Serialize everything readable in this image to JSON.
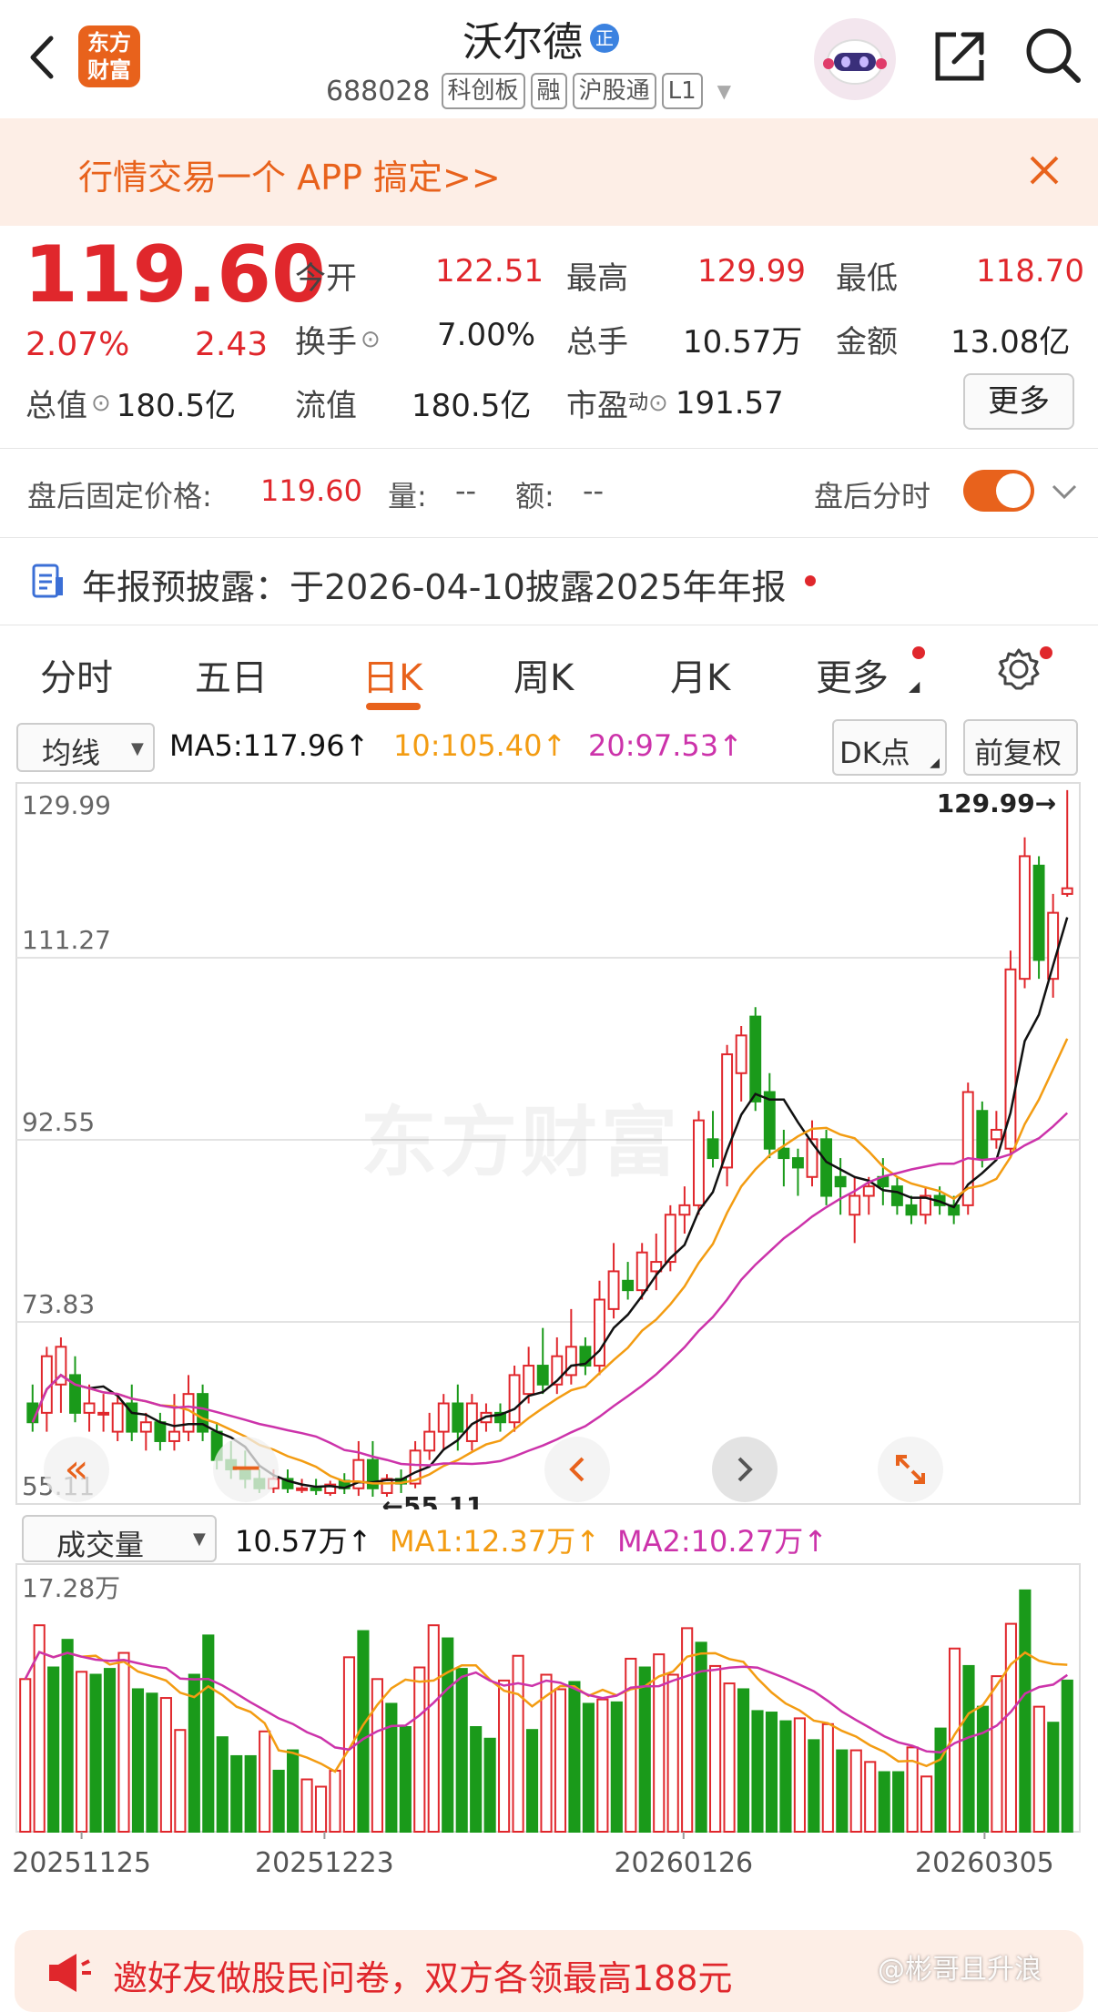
{
  "header": {
    "logo_text": "东方财富",
    "stock_name": "沃尔德",
    "certified_badge": "正",
    "stock_code": "688028",
    "tags": [
      "科创板",
      "融",
      "沪股通",
      "L1"
    ]
  },
  "banner": {
    "text": "行情交易一个 APP 搞定>>"
  },
  "quote": {
    "price": "119.60",
    "change_pct": "2.07%",
    "change_amt": "2.43",
    "open_label": "今开",
    "open": "122.51",
    "high_label": "最高",
    "high": "129.99",
    "low_label": "最低",
    "low": "118.70",
    "turnover_label": "换手",
    "turnover": "7.00%",
    "volume_label": "总手",
    "volume": "10.57万",
    "amount_label": "金额",
    "amount": "13.08亿",
    "mktcap_label": "总值",
    "mktcap": "180.5亿",
    "float_label": "流值",
    "float": "180.5亿",
    "pe_label": "市盈",
    "pe_sup": "动",
    "pe": "191.57",
    "more_button": "更多"
  },
  "after_hours": {
    "price_label": "盘后固定价格:",
    "price": "119.60",
    "vol_label": "量:",
    "vol": "--",
    "amt_label": "额:",
    "amt": "--",
    "timeshare_label": "盘后分时"
  },
  "notice": {
    "text": "年报预披露：于2026-04-10披露2025年年报"
  },
  "tabs": [
    "分时",
    "五日",
    "日K",
    "周K",
    "月K",
    "更多"
  ],
  "active_tab": "日K",
  "kline_toolbar": {
    "indicator": "均线",
    "ma5": "MA5:117.96↑",
    "ma10": "10:105.40↑",
    "ma20": "20:97.53↑",
    "dk_button": "DK点",
    "adjust_button": "前复权"
  },
  "volume_toolbar": {
    "indicator": "成交量",
    "vol": "10.57万↑",
    "ma1": "MA1:12.37万↑",
    "ma2": "MA2:10.27万↑"
  },
  "watermark": "东方财富",
  "footer": {
    "promo_text": "邀好友做股民问卷，双方各领最高188元",
    "weibo_watermark": "@彬哥且升浪"
  },
  "colors": {
    "up": "#e0272c",
    "down": "#1a9a1a",
    "ma5": "#111111",
    "ma10": "#f39c12",
    "ma20": "#cc33aa",
    "accent": "#e8621c",
    "banner_bg": "#fdeee6"
  },
  "chart_data": [
    {
      "type": "candlestick",
      "title": "",
      "y_ticks": [
        "129.99",
        "111.27",
        "92.55",
        "73.83",
        "55.11"
      ],
      "ylim": [
        55.11,
        129.99
      ],
      "max_label": "129.99→",
      "min_label": "←55.11",
      "candles": [
        {
          "o": 65,
          "h": 67,
          "l": 62,
          "c": 63
        },
        {
          "o": 64,
          "h": 71,
          "l": 62,
          "c": 70
        },
        {
          "o": 67,
          "h": 72,
          "l": 64,
          "c": 71
        },
        {
          "o": 68,
          "h": 70,
          "l": 63,
          "c": 64
        },
        {
          "o": 64,
          "h": 67,
          "l": 62,
          "c": 65
        },
        {
          "o": 64,
          "h": 66,
          "l": 62,
          "c": 64
        },
        {
          "o": 62,
          "h": 66,
          "l": 61,
          "c": 65
        },
        {
          "o": 65,
          "h": 67,
          "l": 61,
          "c": 62
        },
        {
          "o": 62,
          "h": 64,
          "l": 60,
          "c": 63
        },
        {
          "o": 63,
          "h": 64,
          "l": 60,
          "c": 61
        },
        {
          "o": 61,
          "h": 66,
          "l": 60,
          "c": 62
        },
        {
          "o": 62,
          "h": 68,
          "l": 61,
          "c": 66
        },
        {
          "o": 66,
          "h": 67,
          "l": 61,
          "c": 62
        },
        {
          "o": 62,
          "h": 63,
          "l": 58,
          "c": 59
        },
        {
          "o": 59,
          "h": 61,
          "l": 57,
          "c": 58
        },
        {
          "o": 58,
          "h": 60,
          "l": 56,
          "c": 57
        },
        {
          "o": 57,
          "h": 58,
          "l": 55.5,
          "c": 56
        },
        {
          "o": 56,
          "h": 58,
          "l": 55.5,
          "c": 57
        },
        {
          "o": 57,
          "h": 58,
          "l": 55.5,
          "c": 56
        },
        {
          "o": 56,
          "h": 57,
          "l": 55.5,
          "c": 56
        },
        {
          "o": 56,
          "h": 57,
          "l": 55.3,
          "c": 55.8
        },
        {
          "o": 55.5,
          "h": 56.8,
          "l": 55.2,
          "c": 56.4
        },
        {
          "o": 56.8,
          "h": 57.6,
          "l": 55.4,
          "c": 56
        },
        {
          "o": 56,
          "h": 61,
          "l": 55.2,
          "c": 59
        },
        {
          "o": 59,
          "h": 61,
          "l": 55.11,
          "c": 56
        },
        {
          "o": 55.5,
          "h": 57.5,
          "l": 55.11,
          "c": 57
        },
        {
          "o": 57,
          "h": 58,
          "l": 55.5,
          "c": 56.5
        },
        {
          "o": 56.5,
          "h": 61,
          "l": 56,
          "c": 60
        },
        {
          "o": 60,
          "h": 64,
          "l": 59,
          "c": 62
        },
        {
          "o": 62,
          "h": 66,
          "l": 60,
          "c": 65
        },
        {
          "o": 65,
          "h": 67,
          "l": 60,
          "c": 62
        },
        {
          "o": 61,
          "h": 66,
          "l": 60,
          "c": 65
        },
        {
          "o": 63,
          "h": 65,
          "l": 62,
          "c": 64
        },
        {
          "o": 64,
          "h": 65,
          "l": 62,
          "c": 63
        },
        {
          "o": 63,
          "h": 69,
          "l": 62,
          "c": 68
        },
        {
          "o": 66,
          "h": 71,
          "l": 65,
          "c": 69
        },
        {
          "o": 69,
          "h": 73,
          "l": 66,
          "c": 67
        },
        {
          "o": 67,
          "h": 72,
          "l": 66,
          "c": 70
        },
        {
          "o": 68,
          "h": 75,
          "l": 67,
          "c": 71
        },
        {
          "o": 71,
          "h": 72,
          "l": 68,
          "c": 69
        },
        {
          "o": 69,
          "h": 78,
          "l": 68,
          "c": 76
        },
        {
          "o": 75,
          "h": 82,
          "l": 74,
          "c": 79
        },
        {
          "o": 78,
          "h": 80,
          "l": 76,
          "c": 77
        },
        {
          "o": 77,
          "h": 82,
          "l": 76,
          "c": 81
        },
        {
          "o": 79,
          "h": 83,
          "l": 77,
          "c": 80
        },
        {
          "o": 80,
          "h": 86,
          "l": 79,
          "c": 85
        },
        {
          "o": 85,
          "h": 88,
          "l": 83,
          "c": 86
        },
        {
          "o": 86,
          "h": 96,
          "l": 85,
          "c": 95
        },
        {
          "o": 93,
          "h": 96,
          "l": 90,
          "c": 91
        },
        {
          "o": 90,
          "h": 103,
          "l": 88,
          "c": 102
        },
        {
          "o": 100,
          "h": 105,
          "l": 97,
          "c": 104
        },
        {
          "o": 106,
          "h": 107,
          "l": 96,
          "c": 97
        },
        {
          "o": 98,
          "h": 100,
          "l": 91,
          "c": 92
        },
        {
          "o": 92,
          "h": 94,
          "l": 88,
          "c": 91
        },
        {
          "o": 91,
          "h": 92,
          "l": 87,
          "c": 90
        },
        {
          "o": 89,
          "h": 95,
          "l": 88,
          "c": 93
        },
        {
          "o": 93,
          "h": 94,
          "l": 86,
          "c": 87
        },
        {
          "o": 89,
          "h": 91,
          "l": 85,
          "c": 88
        },
        {
          "o": 85,
          "h": 89,
          "l": 82,
          "c": 87
        },
        {
          "o": 87,
          "h": 89,
          "l": 85,
          "c": 88
        },
        {
          "o": 89,
          "h": 91,
          "l": 86,
          "c": 88
        },
        {
          "o": 88,
          "h": 89,
          "l": 85,
          "c": 86
        },
        {
          "o": 86,
          "h": 87,
          "l": 84,
          "c": 85
        },
        {
          "o": 85,
          "h": 88,
          "l": 84,
          "c": 87
        },
        {
          "o": 87,
          "h": 88,
          "l": 85,
          "c": 86
        },
        {
          "o": 86,
          "h": 87,
          "l": 84,
          "c": 85
        },
        {
          "o": 86,
          "h": 99,
          "l": 85,
          "c": 98
        },
        {
          "o": 96,
          "h": 97,
          "l": 90,
          "c": 91
        },
        {
          "o": 93,
          "h": 96,
          "l": 92,
          "c": 94
        },
        {
          "o": 92,
          "h": 113,
          "l": 91,
          "c": 111
        },
        {
          "o": 110,
          "h": 125,
          "l": 109,
          "c": 123
        },
        {
          "o": 122,
          "h": 123,
          "l": 110,
          "c": 112
        },
        {
          "o": 110,
          "h": 119,
          "l": 108,
          "c": 117
        },
        {
          "o": 119,
          "h": 130,
          "l": 118.7,
          "c": 119.6
        }
      ]
    },
    {
      "type": "bar",
      "title": "",
      "y_ticks": [
        "17.28万"
      ],
      "ylim": [
        0,
        17.28
      ],
      "x_ticks": [
        "20251125",
        "20251223",
        "20260126",
        "20260305"
      ],
      "values": [
        10.5,
        14.2,
        11.3,
        13.2,
        11,
        10.8,
        11.2,
        12.3,
        9.8,
        9.5,
        9.2,
        7,
        10.8,
        13.5,
        6.5,
        5.2,
        5.2,
        6.9,
        4.2,
        5.6,
        3.6,
        3.1,
        4.2,
        12,
        13.8,
        10.5,
        8.8,
        7.2,
        11.3,
        14.2,
        13.3,
        11.2,
        7.2,
        6.4,
        10.4,
        12.1,
        7,
        10.8,
        9.8,
        10.3,
        8.8,
        9.1,
        8.9,
        11.9,
        11.3,
        12.2,
        10.8,
        14,
        13,
        11.4,
        10.2,
        9.8,
        8.3,
        8.2,
        7.6,
        7.8,
        6.3,
        7.4,
        5.6,
        5.6,
        4.8,
        4.1,
        4.1,
        5.8,
        3.8,
        7.1,
        12.6,
        11.4,
        8.6,
        10.7,
        14.3,
        16.6,
        8.6,
        7.5,
        10.4
      ],
      "up_flags": [
        1,
        1,
        0,
        0,
        1,
        0,
        0,
        1,
        0,
        0,
        1,
        1,
        0,
        0,
        0,
        0,
        0,
        1,
        0,
        0,
        1,
        1,
        1,
        1,
        0,
        1,
        0,
        0,
        1,
        1,
        0,
        0,
        0,
        0,
        1,
        1,
        0,
        1,
        1,
        0,
        0,
        1,
        0,
        1,
        0,
        1,
        1,
        1,
        0,
        1,
        1,
        0,
        0,
        0,
        0,
        1,
        0,
        1,
        0,
        1,
        1,
        0,
        0,
        1,
        1,
        0,
        1,
        0,
        0,
        1,
        1,
        0,
        1,
        0,
        0
      ]
    }
  ]
}
